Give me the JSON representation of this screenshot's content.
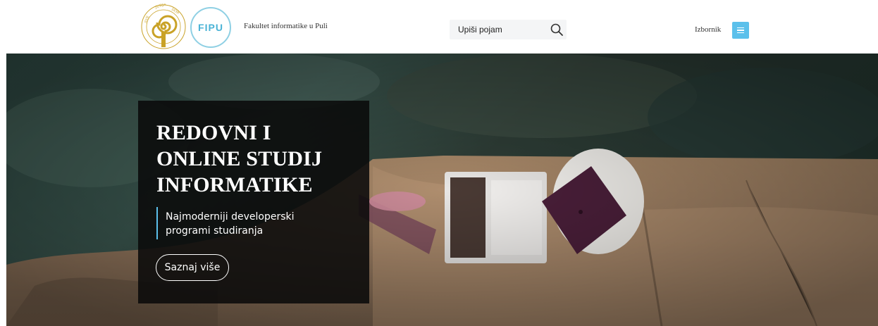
{
  "header": {
    "faculty_name": "Fakultet informatike u Puli",
    "fipu_logo_text": "FIPU",
    "search": {
      "placeholder": "Upiši pojam"
    },
    "menu_label": "Izbornik"
  },
  "hero": {
    "title_lines": [
      "REDOVNI I",
      "ONLINE STUDIJ",
      "INFORMATIKE"
    ],
    "subtitle_lines": [
      "Najmoderniji developerski",
      "programi studiranja"
    ],
    "button_label": "Saznaj više"
  },
  "colors": {
    "accent": "#5bc0eb",
    "fipu_ring": "#8fd0e4",
    "card_bg": "#0a0a0a",
    "unipu_gold": "#c9a227"
  },
  "icons": [
    "university-seal-icon",
    "search-icon",
    "hamburger-menu-icon"
  ]
}
